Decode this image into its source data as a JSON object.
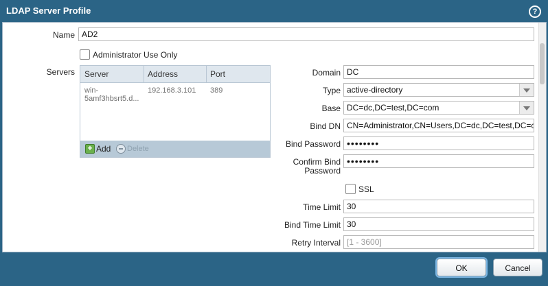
{
  "dialog": {
    "title": "LDAP Server Profile",
    "help_icon": "?"
  },
  "form": {
    "name_label": "Name",
    "name_value": "AD2",
    "admin_only_label": "Administrator Use Only",
    "admin_only_checked": false,
    "servers_label": "Servers",
    "servers_table": {
      "columns": [
        "Server",
        "Address",
        "Port"
      ],
      "rows": [
        {
          "server": "win-5amf3hbsrt5.d...",
          "server_line1": "win-",
          "server_line2": "5amf3hbsrt5.d...",
          "address": "192.168.3.101",
          "port": "389"
        }
      ],
      "add_label": "Add",
      "delete_label": "Delete"
    },
    "domain_label": "Domain",
    "domain_value": "DC",
    "type_label": "Type",
    "type_value": "active-directory",
    "base_label": "Base",
    "base_value": "DC=dc,DC=test,DC=com",
    "bind_dn_label": "Bind DN",
    "bind_dn_value": "CN=Administrator,CN=Users,DC=dc,DC=test,DC=com",
    "bind_password_label": "Bind Password",
    "bind_password_value": "••••••••",
    "confirm_bind_label_line1": "Confirm Bind",
    "confirm_bind_label_line2": "Password",
    "confirm_bind_value": "••••••••",
    "ssl_label": "SSL",
    "ssl_checked": false,
    "time_limit_label": "Time Limit",
    "time_limit_value": "30",
    "bind_time_limit_label": "Bind Time Limit",
    "bind_time_limit_value": "30",
    "retry_interval_label": "Retry Interval",
    "retry_interval_placeholder": "[1 - 3600]"
  },
  "buttons": {
    "ok": "OK",
    "cancel": "Cancel"
  },
  "colors": {
    "frame": "#2b6486",
    "grid_header": "#dfe7ee",
    "grid_footer": "#b7c9d7",
    "add_icon": "#6ab04c"
  }
}
